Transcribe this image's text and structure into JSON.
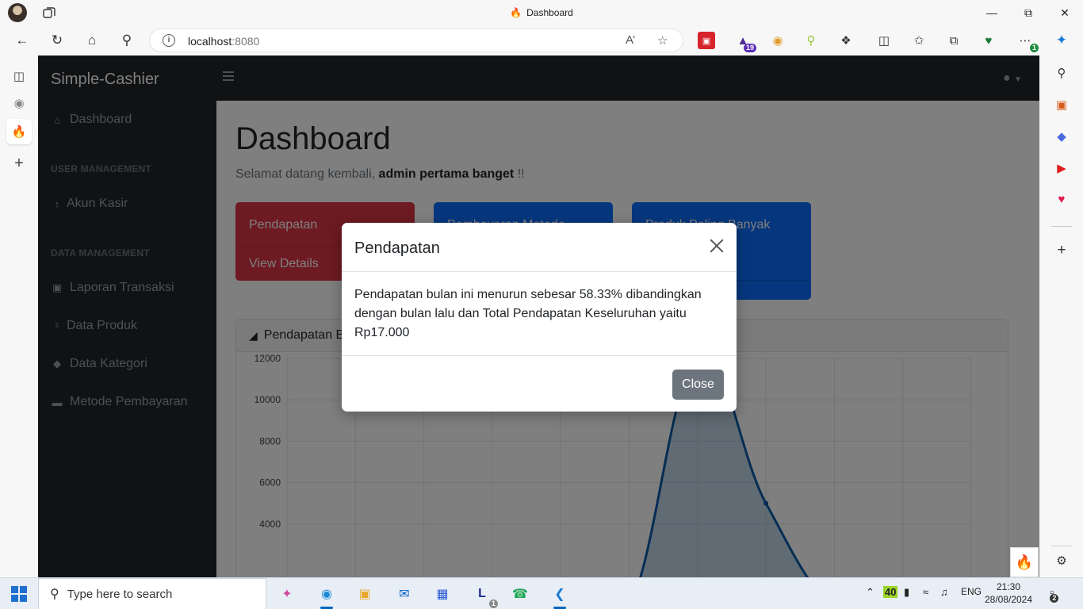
{
  "browser": {
    "window_title": "Dashboard",
    "url_host": "localhost",
    "url_port": ":8080",
    "ext_badge_count": "19",
    "more_badge": "1"
  },
  "app": {
    "brand": "Simple-Cashier",
    "page_title": "Dashboard",
    "welcome_prefix": "Selamat datang kembali, ",
    "welcome_user": "admin pertama banget",
    "welcome_suffix": " !!",
    "sidebar": {
      "dashboard": "Dashboard",
      "heading_user": "USER MANAGEMENT",
      "akun_kasir": "Akun Kasir",
      "heading_data": "DATA MANAGEMENT",
      "laporan_transaksi": "Laporan Transaksi",
      "data_produk": "Data Produk",
      "data_kategori": "Data Kategori",
      "metode_pembayaran": "Metode Pembayaran"
    },
    "cards": [
      {
        "title": "Pendapatan",
        "footer": "View Details"
      },
      {
        "title": "Pembayaran Metode",
        "footer": ""
      },
      {
        "title": "Produk Paling Banyak",
        "footer": ""
      }
    ],
    "chart_header": "Pendapatan B"
  },
  "modal": {
    "title": "Pendapatan",
    "body": "Pendapatan bulan ini menurun sebesar 58.33% dibandingkan dengan bulan lalu dan Total Pendapatan Keseluruhan yaitu Rp17.000",
    "close_label": "Close"
  },
  "chart_data": {
    "type": "area",
    "title": "",
    "xlabel": "",
    "ylabel": "",
    "y_ticks": [
      4000,
      6000,
      8000,
      10000,
      12000
    ],
    "ylim": [
      0,
      12000
    ],
    "x": [
      0,
      1,
      2,
      3,
      4,
      5,
      6,
      7,
      8,
      9,
      10
    ],
    "series": [
      {
        "values": [
          0,
          0,
          0,
          0,
          0,
          0,
          12000,
          5000,
          0,
          0,
          0
        ]
      }
    ],
    "grid": true,
    "color": "#0d5aa7"
  },
  "taskbar": {
    "search_placeholder": "Type here to search",
    "weather_temp": "40",
    "language": "ENG",
    "time": "21:30",
    "date": "28/08/2024",
    "notifications": "2",
    "app_badge": "1"
  }
}
